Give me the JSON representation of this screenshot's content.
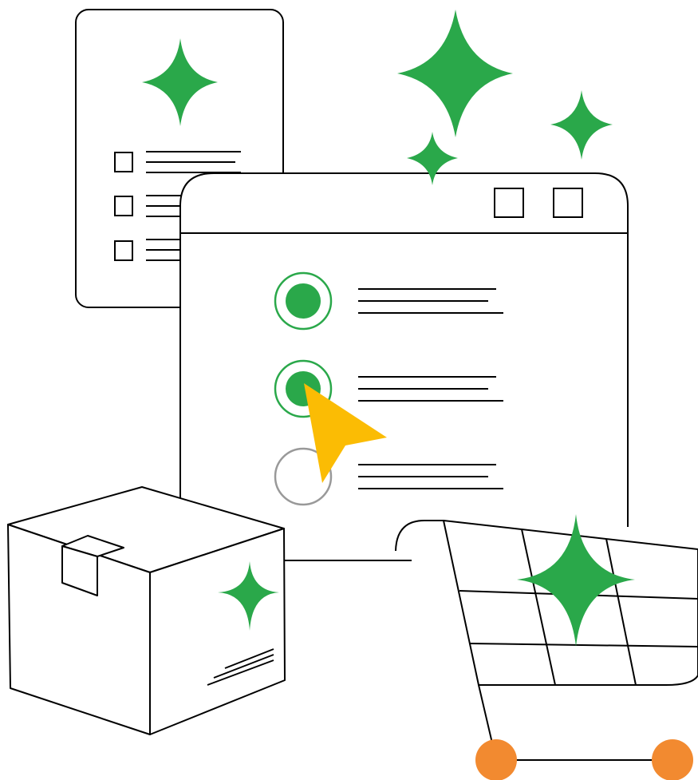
{
  "illustration": {
    "colors": {
      "stroke": "#000000",
      "background": "#ffffff",
      "sparkle": "#2aa84a",
      "radio_selected": "#2aa84a",
      "radio_unselected": "#999999",
      "cursor": "#fbbc04",
      "cart_wheel": "#f28a30"
    },
    "icons": [
      "sparkle-icon",
      "checklist-document",
      "browser-window",
      "radio-button",
      "cursor-arrow-icon",
      "shipping-box",
      "shopping-cart-icon"
    ],
    "radio_options": [
      {
        "selected": true
      },
      {
        "selected": true
      },
      {
        "selected": false
      }
    ],
    "checklist_items": 3
  }
}
